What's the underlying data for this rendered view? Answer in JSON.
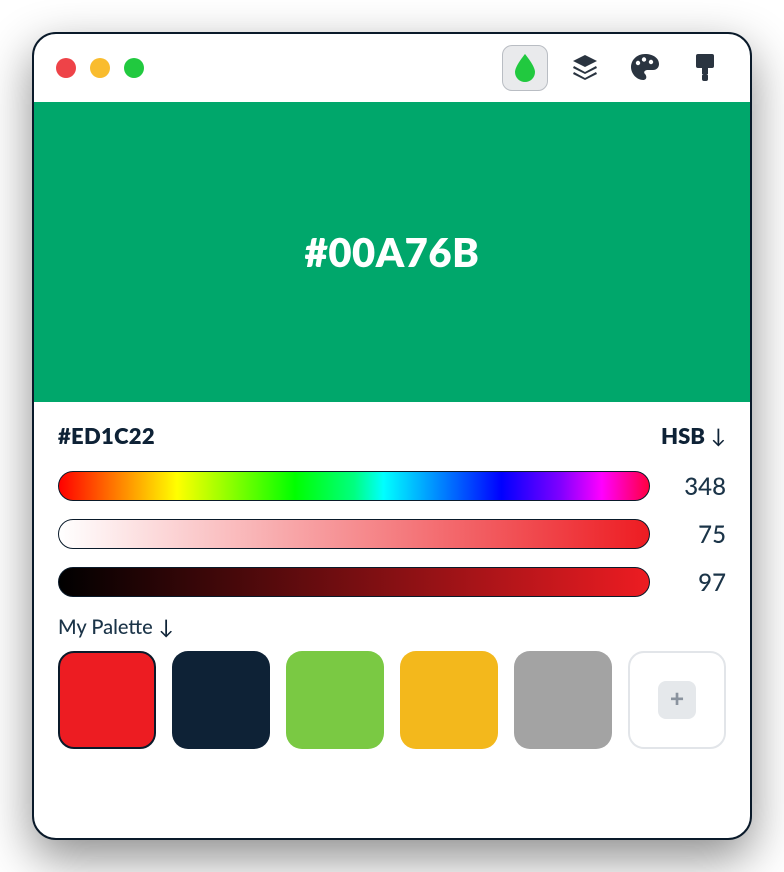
{
  "preview": {
    "hex": "#00A76B",
    "bg": "#00A76B"
  },
  "current_hex": "#ED1C22",
  "mode_label": "HSB",
  "hsb": {
    "hue": 348,
    "saturation": 75,
    "brightness": 97
  },
  "palette_label": "My Palette",
  "palette": [
    {
      "hex": "#ED1C22",
      "selected": true
    },
    {
      "hex": "#0E2236",
      "selected": false
    },
    {
      "hex": "#7AC943",
      "selected": false
    },
    {
      "hex": "#F3B81C",
      "selected": false
    },
    {
      "hex": "#A3A3A3",
      "selected": false
    }
  ],
  "icons": {
    "drop": "drop-icon",
    "layers": "layers-icon",
    "palette": "palette-icon",
    "brush": "brush-icon",
    "plus": "+"
  },
  "colors": {
    "dark": "#2a3440",
    "accent_green": "#21c93f"
  }
}
